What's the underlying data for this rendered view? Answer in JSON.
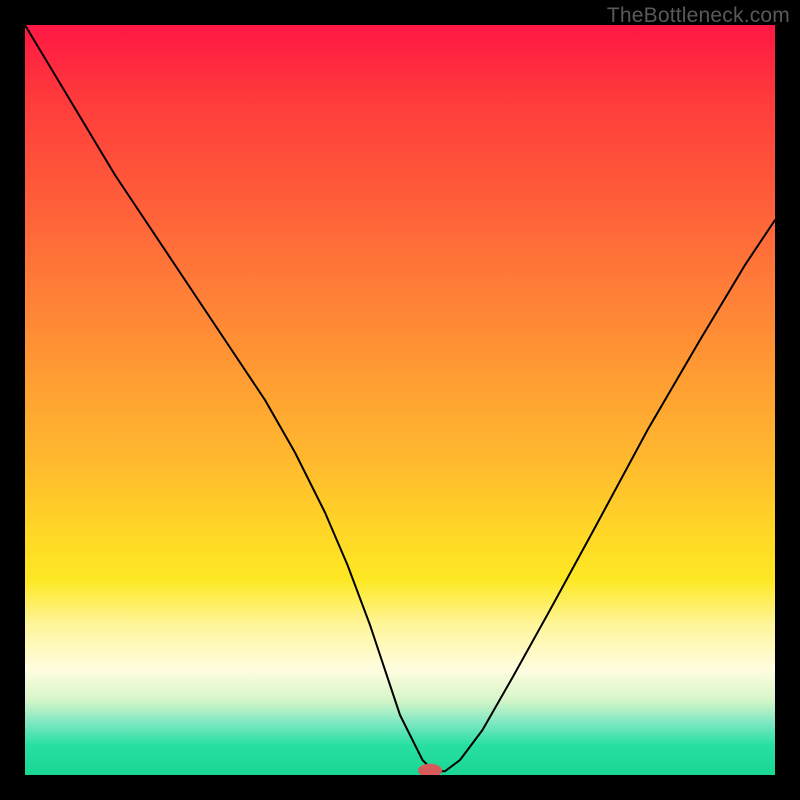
{
  "watermark": "TheBottleneck.com",
  "chart_data": {
    "type": "line",
    "title": "",
    "xlabel": "",
    "ylabel": "",
    "xlim": [
      0,
      100
    ],
    "ylim": [
      0,
      100
    ],
    "grid": false,
    "series": [
      {
        "name": "curve",
        "x": [
          0,
          3,
          6,
          9,
          12,
          16,
          20,
          24,
          28,
          32,
          36,
          40,
          43,
          44.5,
          46,
          48,
          50,
          53,
          54.5,
          56,
          58,
          61,
          65,
          70,
          76,
          83,
          90,
          96,
          100
        ],
        "y": [
          100,
          95,
          90,
          85,
          80,
          74,
          68,
          62,
          56,
          50,
          43,
          35,
          28,
          24,
          20,
          14,
          8,
          2,
          0.5,
          0.5,
          2,
          6,
          13,
          22,
          33,
          46,
          58,
          68,
          74
        ]
      }
    ],
    "marker": {
      "x": 54,
      "y": 0.6,
      "color": "#d65b5a",
      "rx": 1.6,
      "ry": 0.9
    },
    "background_gradient": {
      "top_color": "#ff1744",
      "bottom_color": "#19d792"
    }
  }
}
